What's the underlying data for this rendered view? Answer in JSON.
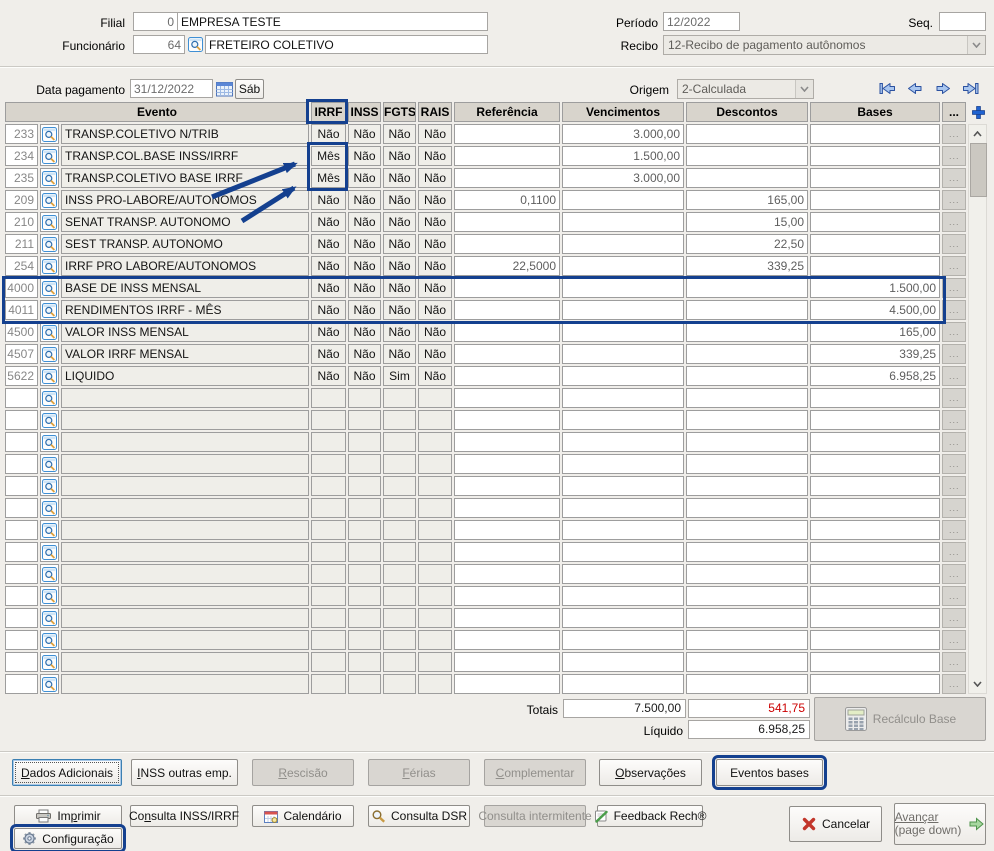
{
  "colors": {
    "annotation": "#14408f",
    "negative": "#cc0000"
  },
  "form": {
    "filial_label": "Filial",
    "filial_code": "0",
    "filial_name": "EMPRESA TESTE",
    "funcionario_label": "Funcionário",
    "funcionario_code": "64",
    "funcionario_name": "FRETEIRO COLETIVO",
    "periodo_label": "Período",
    "periodo_value": "12/2022",
    "seq_label": "Seq.",
    "seq_value": "",
    "recibo_label": "Recibo",
    "recibo_value": "12-Recibo de pagamento autônomos"
  },
  "toolbar": {
    "data_pagamento_label": "Data pagamento",
    "data_pagamento_value": "31/12/2022",
    "weekday_button": "Sáb",
    "origem_label": "Origem",
    "origem_value": "2-Calculada"
  },
  "grid": {
    "columns": [
      "Evento",
      "IRRF",
      "INSS",
      "FGTS",
      "RAIS",
      "Referência",
      "Vencimentos",
      "Descontos",
      "Bases",
      "..."
    ],
    "dots_label": "...",
    "rows": [
      {
        "code": "233",
        "evento": "TRANSP.COLETIVO N/TRIB",
        "irrf": "Não",
        "inss": "Não",
        "fgts": "Não",
        "rais": "Não",
        "referencia": "",
        "vencimentos": "3.000,00",
        "descontos": "",
        "bases": ""
      },
      {
        "code": "234",
        "evento": "TRANSP.COL.BASE INSS/IRRF",
        "irrf": "Mês",
        "inss": "Não",
        "fgts": "Não",
        "rais": "Não",
        "referencia": "",
        "vencimentos": "1.500,00",
        "descontos": "",
        "bases": ""
      },
      {
        "code": "235",
        "evento": "TRANSP.COLETIVO BASE IRRF",
        "irrf": "Mês",
        "inss": "Não",
        "fgts": "Não",
        "rais": "Não",
        "referencia": "",
        "vencimentos": "3.000,00",
        "descontos": "",
        "bases": ""
      },
      {
        "code": "209",
        "evento": "INSS PRO-LABORE/AUTONOMOS",
        "irrf": "Não",
        "inss": "Não",
        "fgts": "Não",
        "rais": "Não",
        "referencia": "0,1100",
        "vencimentos": "",
        "descontos": "165,00",
        "bases": ""
      },
      {
        "code": "210",
        "evento": "SENAT TRANSP. AUTONOMO",
        "irrf": "Não",
        "inss": "Não",
        "fgts": "Não",
        "rais": "Não",
        "referencia": "",
        "vencimentos": "",
        "descontos": "15,00",
        "bases": ""
      },
      {
        "code": "211",
        "evento": "SEST TRANSP. AUTONOMO",
        "irrf": "Não",
        "inss": "Não",
        "fgts": "Não",
        "rais": "Não",
        "referencia": "",
        "vencimentos": "",
        "descontos": "22,50",
        "bases": ""
      },
      {
        "code": "254",
        "evento": "IRRF PRO LABORE/AUTONOMOS",
        "irrf": "Não",
        "inss": "Não",
        "fgts": "Não",
        "rais": "Não",
        "referencia": "22,5000",
        "vencimentos": "",
        "descontos": "339,25",
        "bases": ""
      },
      {
        "code": "4000",
        "evento": "BASE DE INSS MENSAL",
        "irrf": "Não",
        "inss": "Não",
        "fgts": "Não",
        "rais": "Não",
        "referencia": "",
        "vencimentos": "",
        "descontos": "",
        "bases": "1.500,00"
      },
      {
        "code": "4011",
        "evento": "RENDIMENTOS IRRF - MÊS",
        "irrf": "Não",
        "inss": "Não",
        "fgts": "Não",
        "rais": "Não",
        "referencia": "",
        "vencimentos": "",
        "descontos": "",
        "bases": "4.500,00"
      },
      {
        "code": "4500",
        "evento": "VALOR INSS MENSAL",
        "irrf": "Não",
        "inss": "Não",
        "fgts": "Não",
        "rais": "Não",
        "referencia": "",
        "vencimentos": "",
        "descontos": "",
        "bases": "165,00"
      },
      {
        "code": "4507",
        "evento": "VALOR IRRF MENSAL",
        "irrf": "Não",
        "inss": "Não",
        "fgts": "Não",
        "rais": "Não",
        "referencia": "",
        "vencimentos": "",
        "descontos": "",
        "bases": "339,25"
      },
      {
        "code": "5622",
        "evento": "LIQUIDO",
        "irrf": "Não",
        "inss": "Não",
        "fgts": "Sim",
        "rais": "Não",
        "referencia": "",
        "vencimentos": "",
        "descontos": "",
        "bases": "6.958,25"
      }
    ],
    "empty_row_count": 14
  },
  "totals": {
    "totais_label": "Totais",
    "vencimentos_total": "7.500,00",
    "descontos_total": "541,75",
    "liquido_label": "Líquido",
    "liquido_value": "6.958,25",
    "recalculo_base_label": "Recálculo Base"
  },
  "action_tabs": [
    {
      "id": "dados-adicionais",
      "label": "Dados Adicionais",
      "accel": 0,
      "state": "focused"
    },
    {
      "id": "inss-outras-emp",
      "label": "INSS outras emp.",
      "accel": 0,
      "state": "normal"
    },
    {
      "id": "rescisao",
      "label": "Rescisão",
      "accel": 0,
      "state": "disabled"
    },
    {
      "id": "ferias",
      "label": "Férias",
      "accel": 0,
      "state": "disabled"
    },
    {
      "id": "complementar",
      "label": "Complementar",
      "accel": 0,
      "state": "disabled"
    },
    {
      "id": "observacoes",
      "label": "Observações",
      "accel": 0,
      "state": "normal"
    },
    {
      "id": "eventos-bases",
      "label": "Eventos bases",
      "accel": -1,
      "state": "highlighted"
    }
  ],
  "action_buttons": [
    {
      "id": "imprimir",
      "label": "Imprimir",
      "accel": 2,
      "icon": "printer",
      "state": "normal"
    },
    {
      "id": "consulta-inss-irrf",
      "label": "Consulta INSS/IRRF",
      "accel": 2,
      "icon": "",
      "state": "normal"
    },
    {
      "id": "calendario",
      "label": "Calendário",
      "accel": -1,
      "icon": "calendar-small",
      "state": "normal"
    },
    {
      "id": "consulta-dsr",
      "label": "Consulta DSR",
      "accel": -1,
      "icon": "magnifier-gold",
      "state": "normal"
    },
    {
      "id": "consulta-intermitente",
      "label": "Consulta intermitente",
      "accel": -1,
      "icon": "",
      "state": "disabled"
    },
    {
      "id": "feedback-rech",
      "label": "Feedback Rech®",
      "accel": -1,
      "icon": "feedback",
      "state": "normal"
    }
  ],
  "footer_buttons": {
    "configuracao": {
      "label": "Configuração"
    },
    "cancelar": {
      "label": "Cancelar"
    },
    "avancar": {
      "label": "Avançar",
      "sub": "(page down)"
    }
  }
}
